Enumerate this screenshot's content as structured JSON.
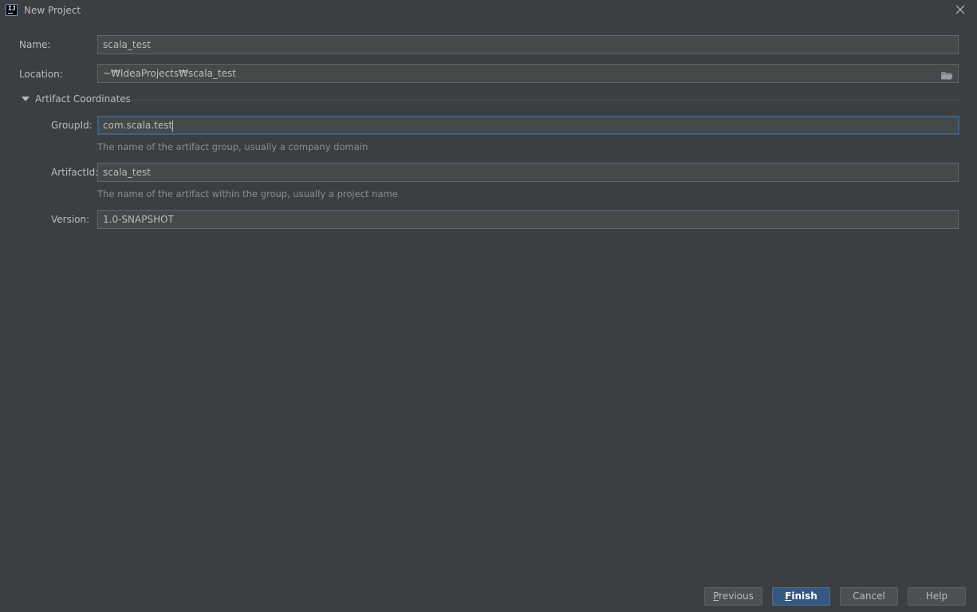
{
  "window": {
    "title": "New Project",
    "app_icon_text": "IJ"
  },
  "form": {
    "name": {
      "label": "Name:",
      "value": "scala_test"
    },
    "location": {
      "label": "Location:",
      "value": "~₩IdeaProjects₩scala_test"
    },
    "artifact_section": {
      "title": "Artifact Coordinates",
      "expanded": true
    },
    "group_id": {
      "label": "GroupId:",
      "value": "com.scala.test",
      "hint": "The name of the artifact group, usually a company domain"
    },
    "artifact_id": {
      "label": "ArtifactId:",
      "value": "scala_test",
      "hint": "The name of the artifact within the group, usually a project name"
    },
    "version": {
      "label": "Version:",
      "value": "1.0-SNAPSHOT"
    }
  },
  "buttons": {
    "previous": {
      "mnemonic": "P",
      "rest": "revious"
    },
    "finish": {
      "mnemonic": "F",
      "rest": "inish"
    },
    "cancel": "Cancel",
    "help": "Help"
  },
  "colors": {
    "background": "#3c3f41",
    "field_background": "#45494a",
    "focus_border": "#3d6185",
    "primary_button": "#365880",
    "text": "#bbbbbb",
    "hint_text": "#8c8c8c"
  },
  "icons": {
    "app": "intellij-idea-icon",
    "close": "close-icon",
    "folder": "folder-icon",
    "section_toggle": "triangle-down-icon"
  }
}
